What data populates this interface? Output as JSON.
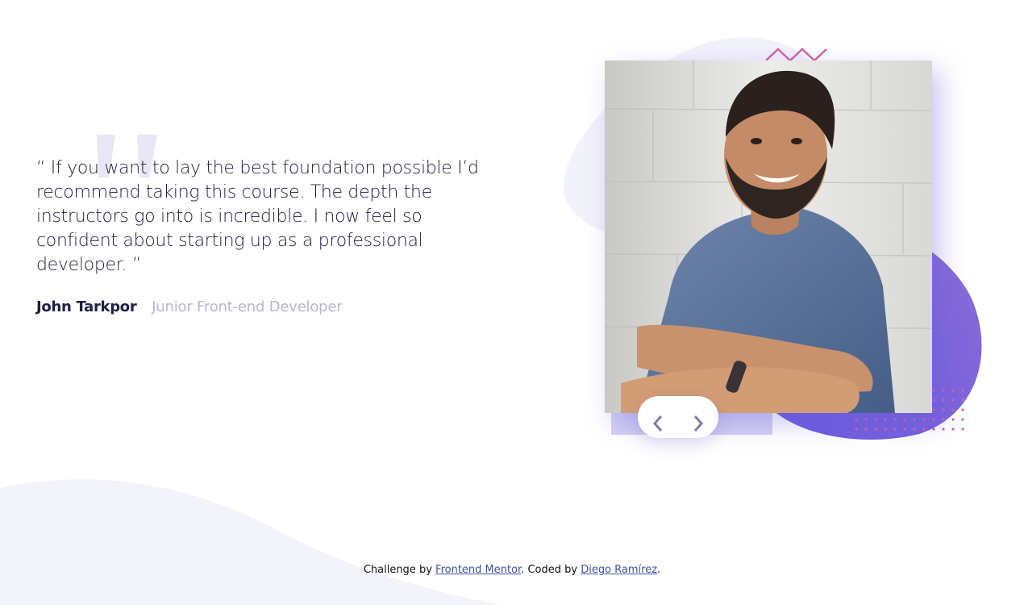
{
  "testimonial": {
    "quote": "“ If you want to lay the best foundation possible I’d recommend taking this course. The depth the instructors go into is incredible. I now feel so confident about starting up as a professional developer. ”",
    "author_name": "John Tarkpor",
    "author_role": "Junior Front-end Developer"
  },
  "navigation": {
    "prev_icon": "chevron-left-icon",
    "next_icon": "chevron-right-icon"
  },
  "footer": {
    "prefix": "Challenge by ",
    "challenge_link": "Frontend Mentor",
    "middle": ". Coded by ",
    "author_link": "Diego Ramírez",
    "suffix": "."
  },
  "colors": {
    "dark_navy": "#202040",
    "grayish_blue": "#b8b7d4",
    "light_wash": "#f0f0fa",
    "purple_gradient_start": "#6a5ae0",
    "purple_gradient_end": "#8c6dd6",
    "pink_accent": "#d166a8",
    "link_blue": "#3e52a3"
  }
}
